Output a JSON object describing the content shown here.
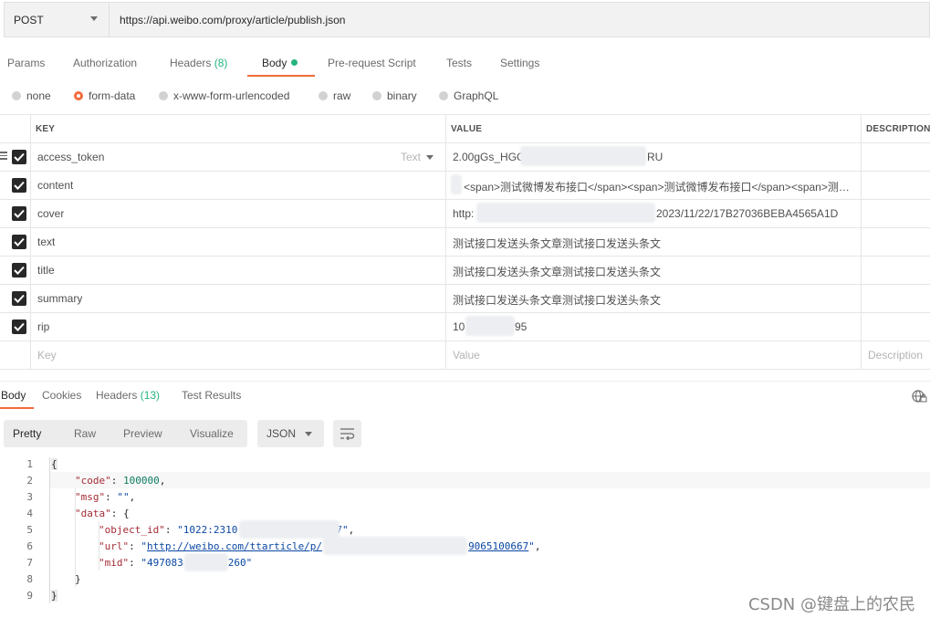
{
  "request": {
    "method": "POST",
    "url": "https://api.weibo.com/proxy/article/publish.json"
  },
  "request_tabs": [
    {
      "label": "Params"
    },
    {
      "label": "Authorization"
    },
    {
      "label": "Headers",
      "count": "(8)"
    },
    {
      "label": "Body"
    },
    {
      "label": "Pre-request Script"
    },
    {
      "label": "Tests"
    },
    {
      "label": "Settings"
    }
  ],
  "body_types": [
    "none",
    "form-data",
    "x-www-form-urlencoded",
    "raw",
    "binary",
    "GraphQL"
  ],
  "selected_body_type": "form-data",
  "table": {
    "headers": {
      "key": "KEY",
      "value": "VALUE",
      "description": "DESCRIPTION"
    },
    "type_label": "Text",
    "rows": [
      {
        "key": "access_token",
        "value": "2.00gGs_HGC",
        "value_tail": "RU"
      },
      {
        "key": "content",
        "value": "<span>测试微博发布接口</span><span>测试微博发布接口</span><span>测…"
      },
      {
        "key": "cover",
        "value": "http:",
        "value_tail": "2023/11/22/17B27036BEBA4565A1D"
      },
      {
        "key": "text",
        "value": "测试接口发送头条文章测试接口发送头条文"
      },
      {
        "key": "title",
        "value": "测试接口发送头条文章测试接口发送头条文"
      },
      {
        "key": "summary",
        "value": "测试接口发送头条文章测试接口发送头条文"
      },
      {
        "key": "rip",
        "value": "10",
        "value_tail": "95"
      }
    ],
    "placeholder": {
      "key": "Key",
      "value": "Value",
      "description": "Description"
    }
  },
  "response_tabs": [
    {
      "label": "Body"
    },
    {
      "label": "Cookies"
    },
    {
      "label": "Headers",
      "count": "(13)"
    },
    {
      "label": "Test Results"
    }
  ],
  "view_modes": [
    "Pretty",
    "Raw",
    "Preview",
    "Visualize"
  ],
  "format": "JSON",
  "code": {
    "line_numbers": [
      "1",
      "2",
      "3",
      "4",
      "5",
      "6",
      "7",
      "8",
      "9"
    ],
    "open_brace": "{",
    "close_brace": "}",
    "inner_close": "}",
    "code_key": "\"code\"",
    "code_val": "100000",
    "msg_key": "\"msg\"",
    "msg_val": "\"\"",
    "data_key": "\"data\"",
    "data_open": "{",
    "object_id_key": "\"object_id\"",
    "object_id_val_start": "\"1022:2310",
    "object_id_val_end": "7\"",
    "url_key": "\"url\"",
    "url_val_start": "http://weibo.com/ttarticle/p/",
    "url_val_end": "9065100667",
    "mid_key": "\"mid\"",
    "mid_val_start": "\"497083",
    "mid_val_end": "260\""
  },
  "watermark": "CSDN @键盘上的农民"
}
